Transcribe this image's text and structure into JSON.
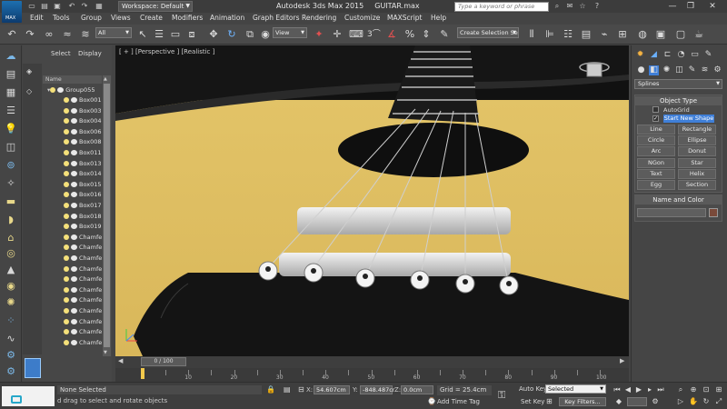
{
  "titlebar": {
    "logo_text": "MAX",
    "workspace": "Workspace: Default",
    "app_title": "Autodesk 3ds Max  2015",
    "file_name": "GUITAR.max",
    "search_placeholder": "Type a keyword or phrase"
  },
  "menu": [
    "Edit",
    "Tools",
    "Group",
    "Views",
    "Create",
    "Modifiers",
    "Animation",
    "Graph Editors",
    "Rendering",
    "Customize",
    "MAXScript",
    "Help"
  ],
  "toolbar": {
    "selection_filter": "All",
    "reference_coord": "View",
    "snap_value": "3",
    "named_selection": "Create Selection Se"
  },
  "explorer": {
    "tabs": [
      "Select",
      "Display"
    ],
    "column_header": "Name",
    "group_label": "Group055",
    "rows": [
      "Box001",
      "Box003",
      "Box004",
      "Box006",
      "Box008",
      "Box011",
      "Box013",
      "Box014",
      "Box015",
      "Box016",
      "Box017",
      "Box018",
      "Box019",
      "Chamfe",
      "Chamfe",
      "Chamfe",
      "Chamfe",
      "Chamfe",
      "Chamfe",
      "Chamfe",
      "Chamfe",
      "Chamfe",
      "Chamfe",
      "Chamfe"
    ]
  },
  "viewport": {
    "label": "[ + ] [Perspective ] [Realistic ]"
  },
  "timeline": {
    "slider": "0 / 100",
    "ticks": [
      "10",
      "20",
      "30",
      "40",
      "50",
      "60",
      "70",
      "80",
      "90",
      "100"
    ]
  },
  "command_panel": {
    "category": "Splines",
    "object_type_header": "Object Type",
    "autogrid": "AutoGrid",
    "start_new_shape": "Start New Shape",
    "buttons": [
      "Line",
      "Rectangle",
      "Circle",
      "Ellipse",
      "Arc",
      "Donut",
      "NGon",
      "Star",
      "Text",
      "Helix",
      "Egg",
      "Section"
    ],
    "name_color_header": "Name and Color"
  },
  "statusbar": {
    "selection": "None Selected",
    "prompt": "d drag to select and rotate objects",
    "x_label": "X:",
    "x_value": "54.607cm",
    "y_label": "Y:",
    "y_value": "-848.487cr",
    "z_label": "Z:",
    "z_value": "0.0cm",
    "grid": "Grid = 25.4cm",
    "add_time_tag": "Add Time Tag",
    "auto_key": "Auto Key",
    "set_key": "Set Key",
    "selected_value": "Selected",
    "key_filters": "Key Filters..."
  }
}
